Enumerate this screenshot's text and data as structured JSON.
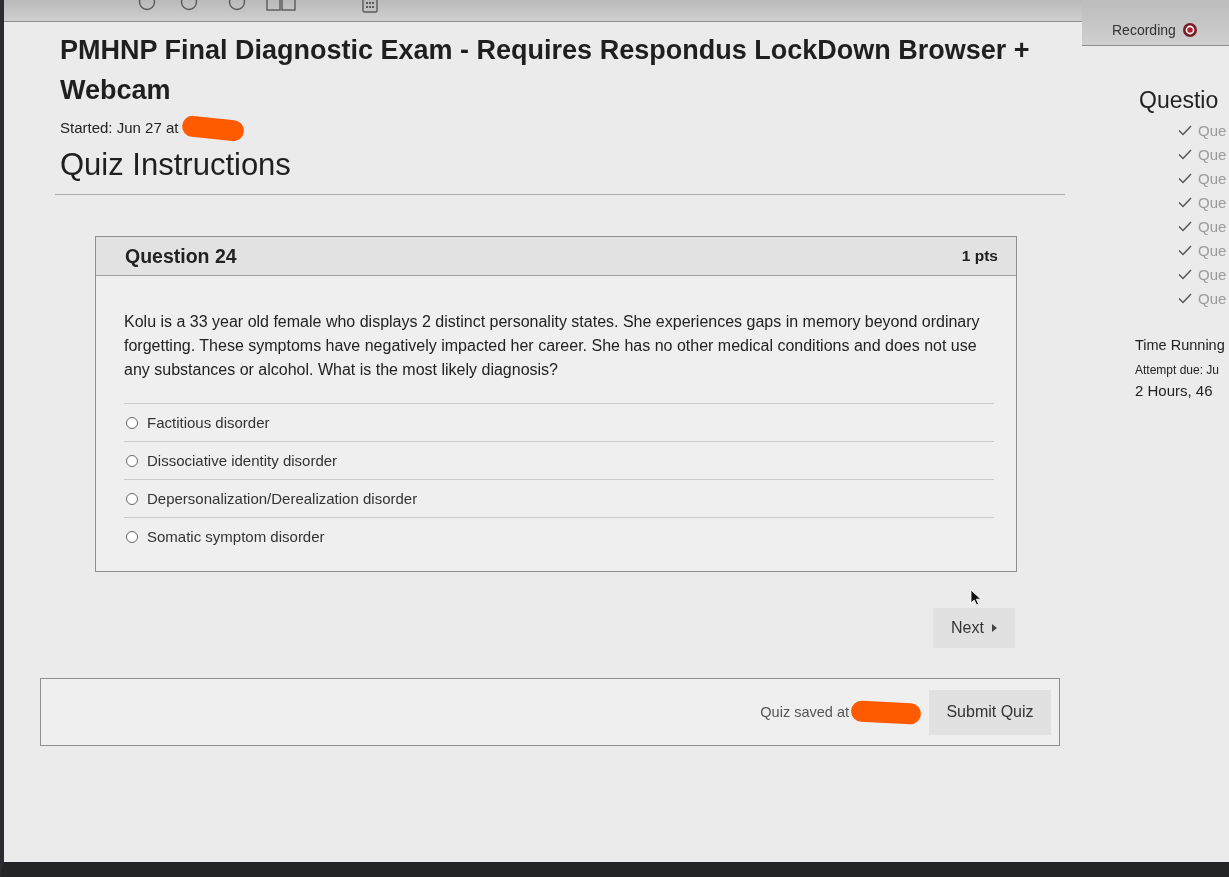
{
  "header": {
    "title": "PMHNP Final Diagnostic Exam - Requires Respondus LockDown Browser + Webcam",
    "started": {
      "text": "Started: Jun 27 at",
      "redacted": true
    },
    "section_title": "Quiz Instructions"
  },
  "question": {
    "title": "Question 24",
    "points": "1 pts",
    "text": "Kolu is a 33 year old female who displays 2 distinct personality states. She experiences gaps in memory beyond ordinary forgetting. These symptoms have negatively impacted her career. She has no other medical conditions and does not use any substances or alcohol. What is the most likely diagnosis?",
    "answers": [
      {
        "label": "Factitious disorder",
        "selected": false
      },
      {
        "label": "Dissociative identity disorder",
        "selected": false
      },
      {
        "label": "Depersonalization/Derealization disorder",
        "selected": false
      },
      {
        "label": "Somatic symptom disorder",
        "selected": false
      }
    ]
  },
  "navigation": {
    "next_button": "Next"
  },
  "footer": {
    "saved": {
      "text": "Quiz saved at",
      "redacted": true
    },
    "submit_button": "Submit Quiz"
  },
  "sidebar": {
    "recording": {
      "label": "Recording",
      "on": true
    },
    "questions_heading": "Questio",
    "questions": [
      {
        "label": "Que",
        "answered": true
      },
      {
        "label": "Que",
        "answered": true
      },
      {
        "label": "Que",
        "answered": true
      },
      {
        "label": "Que",
        "answered": true
      },
      {
        "label": "Que",
        "answered": true
      },
      {
        "label": "Que",
        "answered": true
      },
      {
        "label": "Que",
        "answered": true
      },
      {
        "label": "Que",
        "answered": true
      }
    ],
    "time_label": "Time Running",
    "attempt_due": "Attempt due: Ju",
    "time_remaining": "2 Hours, 46"
  }
}
